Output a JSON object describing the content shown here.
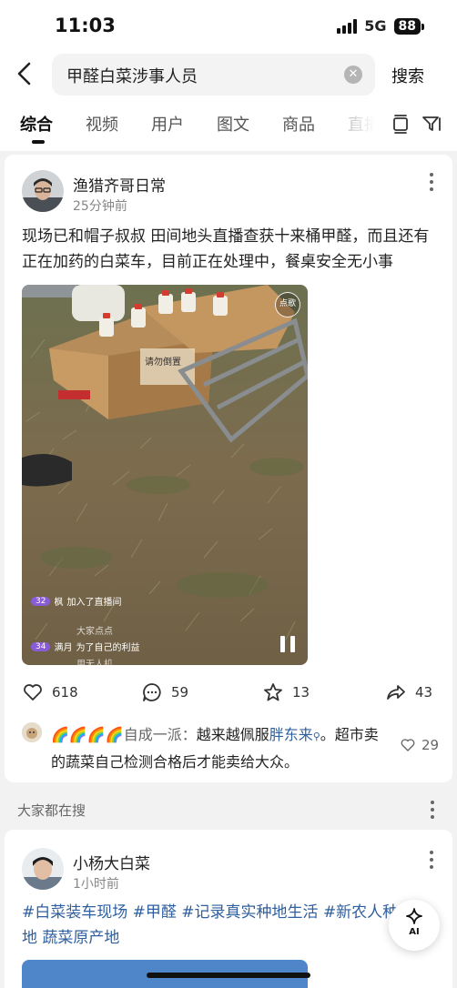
{
  "status": {
    "time": "11:03",
    "network": "5G",
    "battery": "88"
  },
  "search": {
    "query": "甲醛白菜涉事人员",
    "button": "搜索"
  },
  "tabs": [
    "综合",
    "视频",
    "用户",
    "图文",
    "商品",
    "直播"
  ],
  "post": {
    "author": "渔猎齐哥日常",
    "time": "25分钟前",
    "text": "现场已和帽子叔叔 田间地头直播查获十来桶甲醛，而且还有正在加药的白菜车，目前正在处理中，餐桌安全无小事",
    "media": {
      "badge": "点歌",
      "box_label": "请勿倒置",
      "live_comments": [
        {
          "level": "32",
          "name": "枫",
          "text": "加入了直播间"
        },
        {
          "level": "",
          "name": "",
          "text": "大家点点"
        },
        {
          "level": "34",
          "name": "满月",
          "text": "为了自己的利益"
        },
        {
          "level": "",
          "name": "",
          "text": "用无人机"
        }
      ]
    },
    "actions": {
      "likes": "618",
      "comments": "59",
      "favorites": "13",
      "shares": "43"
    },
    "top_comment": {
      "emojis": "🌈🌈🌈🌈",
      "name": "自成一派：",
      "text_before": "越来越佩服",
      "link": "胖东来",
      "text_after": "。超市卖的蔬菜自己检测合格后才能卖给大众。",
      "likes": "29"
    }
  },
  "section": {
    "title": "大家都在搜"
  },
  "post2": {
    "author": "小杨大白菜",
    "time": "1小时前",
    "hashtags": "#白菜装车现场 #甲醛 #记录真实种地生活 #新农人种地 蔬菜原产地"
  },
  "ai_button": {
    "label": "AI"
  },
  "colors": {
    "link": "#2f5f9f",
    "background": "#f2f2f2",
    "text": "#222222"
  }
}
